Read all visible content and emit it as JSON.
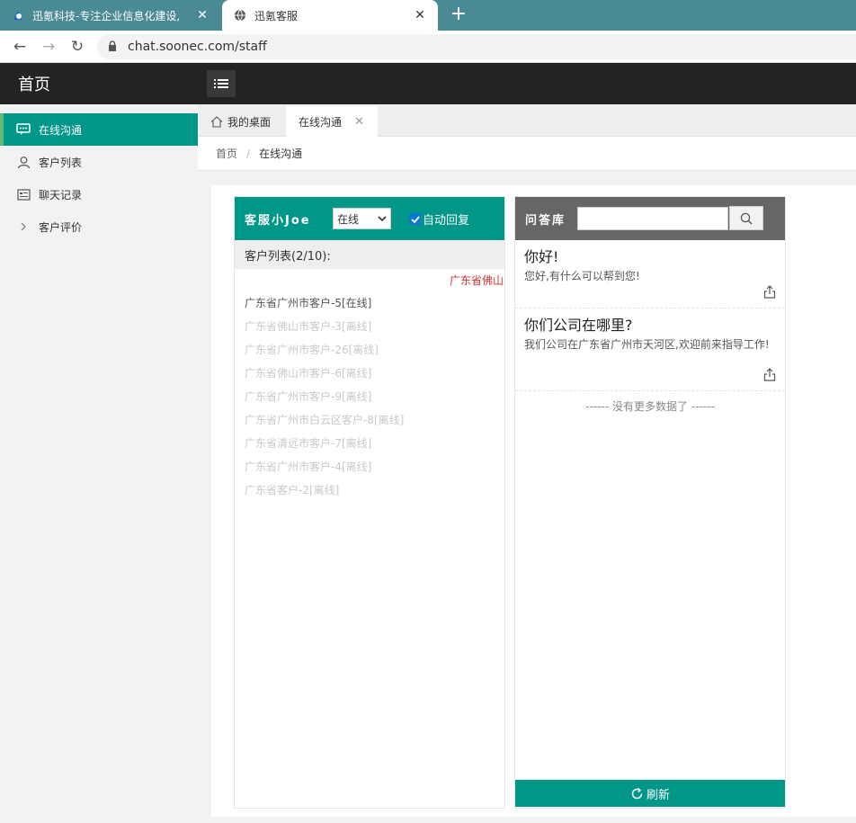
{
  "browser": {
    "tabs": [
      {
        "title": "迅氪科技-专注企业信息化建设,",
        "active": false
      },
      {
        "title": "迅氪客服",
        "active": true
      }
    ],
    "url": "chat.soonec.com/staff"
  },
  "header": {
    "brand": "首页"
  },
  "sidebar": {
    "items": [
      {
        "label": "在线沟通",
        "icon": "chat-icon",
        "active": true
      },
      {
        "label": "客户列表",
        "icon": "user-icon",
        "active": false
      },
      {
        "label": "聊天记录",
        "icon": "record-icon",
        "active": false
      },
      {
        "label": "客户评价",
        "icon": "chevron-right-icon",
        "active": false
      }
    ]
  },
  "page_tabs": {
    "home": "我的桌面",
    "current": "在线沟通"
  },
  "breadcrumb": {
    "home": "首页",
    "sep": "/",
    "current": "在线沟通"
  },
  "service": {
    "agent_name": "客服小Joe",
    "status_selected": "在线",
    "auto_reply_label": "自动回复",
    "auto_reply_checked": true,
    "customer_list_header": "客户列表(2/10):",
    "marquee_text": "广东省佛山",
    "customers": [
      {
        "label": "广东省广州市客户-5[在线]",
        "online": true
      },
      {
        "label": "广东省佛山市客户-3[离线]",
        "online": false
      },
      {
        "label": "广东省广州市客户-26[离线]",
        "online": false
      },
      {
        "label": "广东省佛山市客户-6[离线]",
        "online": false
      },
      {
        "label": "广东省广州市客户-9[离线]",
        "online": false
      },
      {
        "label": "广东省广州市白云区客户-8[离线]",
        "online": false
      },
      {
        "label": "广东省清远市客户-7[离线]",
        "online": false
      },
      {
        "label": "广东省广州市客户-4[离线]",
        "online": false
      },
      {
        "label": "广东省客户-2[离线]",
        "online": false
      }
    ]
  },
  "qa": {
    "title": "问答库",
    "search_placeholder": "",
    "items": [
      {
        "question": "你好!",
        "answer": "您好,有什么可以帮到您!"
      },
      {
        "question": "你们公司在哪里?",
        "answer": "我们公司在广东省广州市天河区,欢迎前来指导工作!"
      }
    ],
    "no_more": "------ 没有更多数据了 ------",
    "refresh_label": "刷新"
  },
  "colors": {
    "primary": "#009688",
    "header": "#232323",
    "qa_header": "#666666",
    "browser_tab": "#4a8a95"
  }
}
